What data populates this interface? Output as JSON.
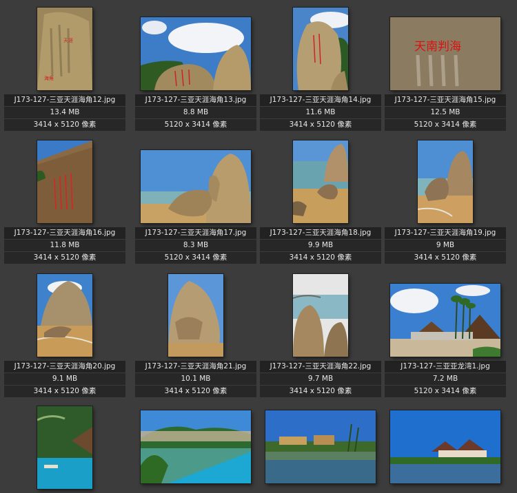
{
  "photos": [
    {
      "name": "J173-127-三亚天涯海角12.jpg",
      "size": "13.4 MB",
      "dims": "3414 x 5120 像素"
    },
    {
      "name": "J173-127-三亚天涯海角13.jpg",
      "size": "8.8 MB",
      "dims": "5120 x 3414 像素"
    },
    {
      "name": "J173-127-三亚天涯海角14.jpg",
      "size": "11.6 MB",
      "dims": "3414 x 5120 像素"
    },
    {
      "name": "J173-127-三亚天涯海角15.jpg",
      "size": "12.5 MB",
      "dims": "5120 x 3414 像素"
    },
    {
      "name": "J173-127-三亚天涯海角16.jpg",
      "size": "11.8 MB",
      "dims": "3414 x 5120 像素"
    },
    {
      "name": "J173-127-三亚天涯海角17.jpg",
      "size": "8.3 MB",
      "dims": "5120 x 3414 像素"
    },
    {
      "name": "J173-127-三亚天涯海角18.jpg",
      "size": "9.9 MB",
      "dims": "3414 x 5120 像素"
    },
    {
      "name": "J173-127-三亚天涯海角19.jpg",
      "size": "9 MB",
      "dims": "3414 x 5120 像素"
    },
    {
      "name": "J173-127-三亚天涯海角20.jpg",
      "size": "9.1 MB",
      "dims": "3414 x 5120 像素"
    },
    {
      "name": "J173-127-三亚天涯海角21.jpg",
      "size": "10.1 MB",
      "dims": "3414 x 5120 像素"
    },
    {
      "name": "J173-127-三亚天涯海角22.jpg",
      "size": "9.7 MB",
      "dims": "3414 x 5120 像素"
    },
    {
      "name": "J173-127-三亚亚龙湾1.jpg",
      "size": "7.2 MB",
      "dims": "5120 x 3414 像素"
    }
  ],
  "bottom_row_thumbs": [
    "resort-pool-portrait",
    "resort-pool-landscape",
    "resort-lake-landscape",
    "resort-villa-landscape"
  ],
  "rock_inscriptions": {
    "tianya": "天涯",
    "haijiao": "海角",
    "nantian": "天南判海"
  }
}
